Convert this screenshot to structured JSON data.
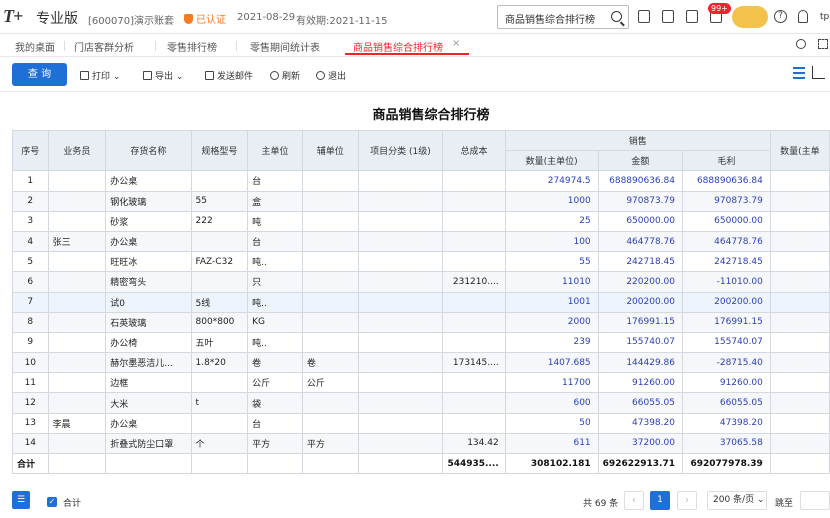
{
  "app": {
    "logo": "T+",
    "edition": "专业版",
    "account": "[600070]演示账套",
    "certified": "已认证",
    "date": "2021-08-29",
    "expiry": "有效期:2021-11-15",
    "search_text": "商品销售综合排行榜",
    "badge": "99+",
    "user_initials": "tp"
  },
  "tabs": [
    "我的桌面",
    "门店客群分析",
    "零售排行榜",
    "零售期间统计表",
    "商品销售综合排行榜"
  ],
  "toolbar": {
    "query": "查 询",
    "print": "打印",
    "export": "导出",
    "send_mail": "发送邮件",
    "refresh": "刷新",
    "exit": "退出"
  },
  "report": {
    "title": "商品销售综合排行榜",
    "group_sales": "销售",
    "columns": [
      "序号",
      "业务员",
      "存货名称",
      "规格型号",
      "主单位",
      "辅单位",
      "项目分类 (1级)",
      "总成本",
      "数量(主单位)",
      "金额",
      "毛利",
      "数量(主单"
    ],
    "rows": [
      [
        "1",
        "",
        "办公桌",
        "",
        "台",
        "",
        "",
        "",
        "274974.5",
        "688890636.84",
        "688890636.84",
        ""
      ],
      [
        "2",
        "",
        "钢化玻璃",
        "55",
        "盒",
        "",
        "",
        "",
        "1000",
        "970873.79",
        "970873.79",
        ""
      ],
      [
        "3",
        "",
        "砂浆",
        "222",
        "吨",
        "",
        "",
        "",
        "25",
        "650000.00",
        "650000.00",
        ""
      ],
      [
        "4",
        "张三",
        "办公桌",
        "",
        "台",
        "",
        "",
        "",
        "100",
        "464778.76",
        "464778.76",
        ""
      ],
      [
        "5",
        "",
        "旺旺冰",
        "FAZ-C32",
        "吨..",
        "",
        "",
        "",
        "55",
        "242718.45",
        "242718.45",
        ""
      ],
      [
        "6",
        "",
        "精密弯头",
        "",
        "只",
        "",
        "",
        "231210....",
        "11010",
        "220200.00",
        "-11010.00",
        ""
      ],
      [
        "7",
        "",
        "试0",
        "5线",
        "吨..",
        "",
        "",
        "",
        "1001",
        "200200.00",
        "200200.00",
        ""
      ],
      [
        "8",
        "",
        "石英玻璃",
        "800*800",
        "KG",
        "",
        "",
        "",
        "2000",
        "176991.15",
        "176991.15",
        ""
      ],
      [
        "9",
        "",
        "办公椅",
        "五叶",
        "吨..",
        "",
        "",
        "",
        "239",
        "155740.07",
        "155740.07",
        ""
      ],
      [
        "10",
        "",
        "赫尔墨恶洁儿...",
        "1.8*20",
        "卷",
        "卷",
        "",
        "173145....",
        "1407.685",
        "144429.86",
        "-28715.40",
        ""
      ],
      [
        "11",
        "",
        "边框",
        "",
        "公斤",
        "公斤",
        "",
        "",
        "11700",
        "91260.00",
        "91260.00",
        ""
      ],
      [
        "12",
        "",
        "大米",
        "t",
        "袋",
        "",
        "",
        "",
        "600",
        "66055.05",
        "66055.05",
        ""
      ],
      [
        "13",
        "李晨",
        "办公桌",
        "",
        "台",
        "",
        "",
        "",
        "50",
        "47398.20",
        "47398.20",
        ""
      ],
      [
        "14",
        "",
        "折叠式防尘口罩",
        "个",
        "平方",
        "平方",
        "",
        "134.42",
        "611",
        "37200.00",
        "37065.58",
        ""
      ]
    ],
    "total": [
      "合计",
      "",
      "",
      "",
      "",
      "",
      "",
      "544935....",
      "308102.181",
      "692622913.71",
      "692077978.39",
      ""
    ]
  },
  "footer": {
    "total_checkbox": "合计",
    "count": "共 69 条",
    "current_page": "1",
    "page_size": "200 条/页",
    "jump": "跳至"
  },
  "colors": {
    "accent": "#1f6fd6",
    "active_tab": "#f5222d",
    "header_bg": "#e9eef5"
  }
}
